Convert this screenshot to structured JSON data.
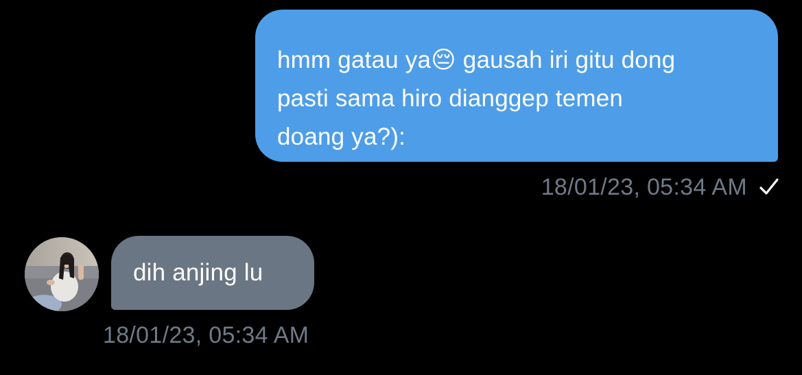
{
  "conversation": {
    "outgoing": {
      "text": "hmm gatau ya😔 gausah iri gitu dong\npasti sama hiro dianggep temen\ndoang ya?):",
      "timestamp": "18/01/23, 05:34 AM",
      "status_icon": "check-icon"
    },
    "incoming": {
      "text": "dih anjing lu",
      "timestamp": "18/01/23, 05:34 AM",
      "avatar": "avatar-photo"
    }
  },
  "colors": {
    "background": "#000000",
    "outgoing_bubble": "#4e9de8",
    "incoming_bubble": "#6b7684",
    "timestamp": "#6f7a87",
    "text": "#ffffff"
  }
}
